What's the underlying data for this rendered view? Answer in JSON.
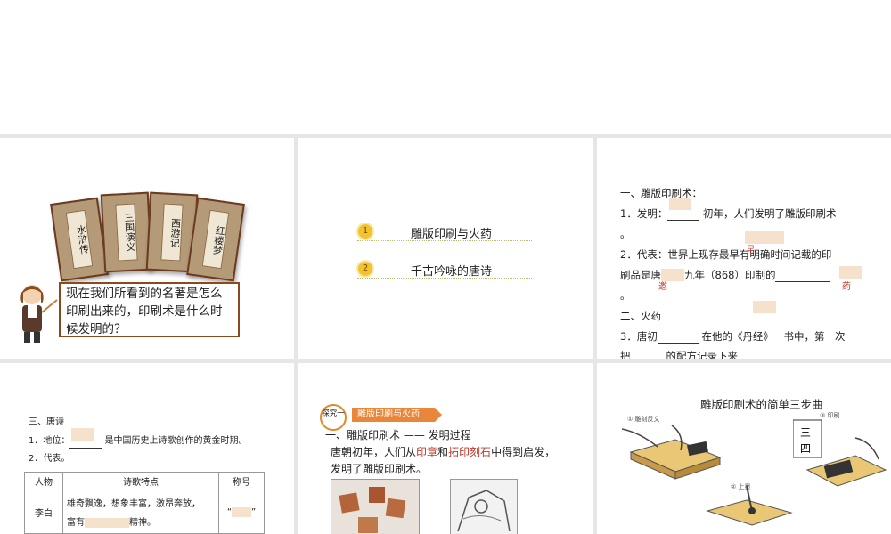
{
  "slide1": {
    "books": [
      "水浒传",
      "三国演义",
      "西游记",
      "红楼梦"
    ],
    "question": "现在我们所看到的名著是怎么印刷出来的，印刷术是什么时候发明的？"
  },
  "slide2": {
    "toc": [
      {
        "num": "1",
        "label": "雕版印刷与火药"
      },
      {
        "num": "2",
        "label": "千古吟咏的唐诗"
      }
    ]
  },
  "slide3": {
    "h1": "一、雕版印刷术：",
    "l1a": "1．发明：",
    "l1b": "初年，人们发明了雕版印刷术",
    "l1c": "。",
    "l2a": "2．代表：世界上现存最早有明确时间记载的印",
    "l2b": "刷品是唐",
    "l2c": "九年（868）印制的",
    "l2d": "。",
    "red1": "邀",
    "red2": "药",
    "h2": "二、火药",
    "l3a": "3．唐初",
    "l3b": "在他的《丹经》一书中，第一次",
    "l3c": "把",
    "l3d": "的配方记录下来"
  },
  "slide4": {
    "h": "三、唐诗",
    "l1a": "1．地位：",
    "l1b": "是中国历史上诗歌创作的黄金时期。",
    "l2": "2．代表。",
    "cols": [
      "人物",
      "诗歌特点",
      "称号"
    ],
    "row_name": "李白",
    "row_feat1": "雄奇飘逸，想象丰富，激昂奔放，",
    "row_feat2a": "富有",
    "row_feat2b": "精神。",
    "quote_open": "“",
    "quote_close": "”"
  },
  "slide5": {
    "badge": "探究一",
    "banner": "雕版印刷与火药",
    "title": "一、雕版印刷术 —— 发明过程",
    "p1a": "唐朝初年，人们从",
    "p1b": "印章",
    "p1c": "和",
    "p1d": "拓印刻石",
    "p1e": "中得到启发，",
    "p2": "发明了雕版印刷术。"
  },
  "slide6": {
    "title": "雕版印刷术的简单三步曲",
    "step1": "① 雕刻反文",
    "step2": "② 上墨",
    "step3": "③ 印刷"
  }
}
